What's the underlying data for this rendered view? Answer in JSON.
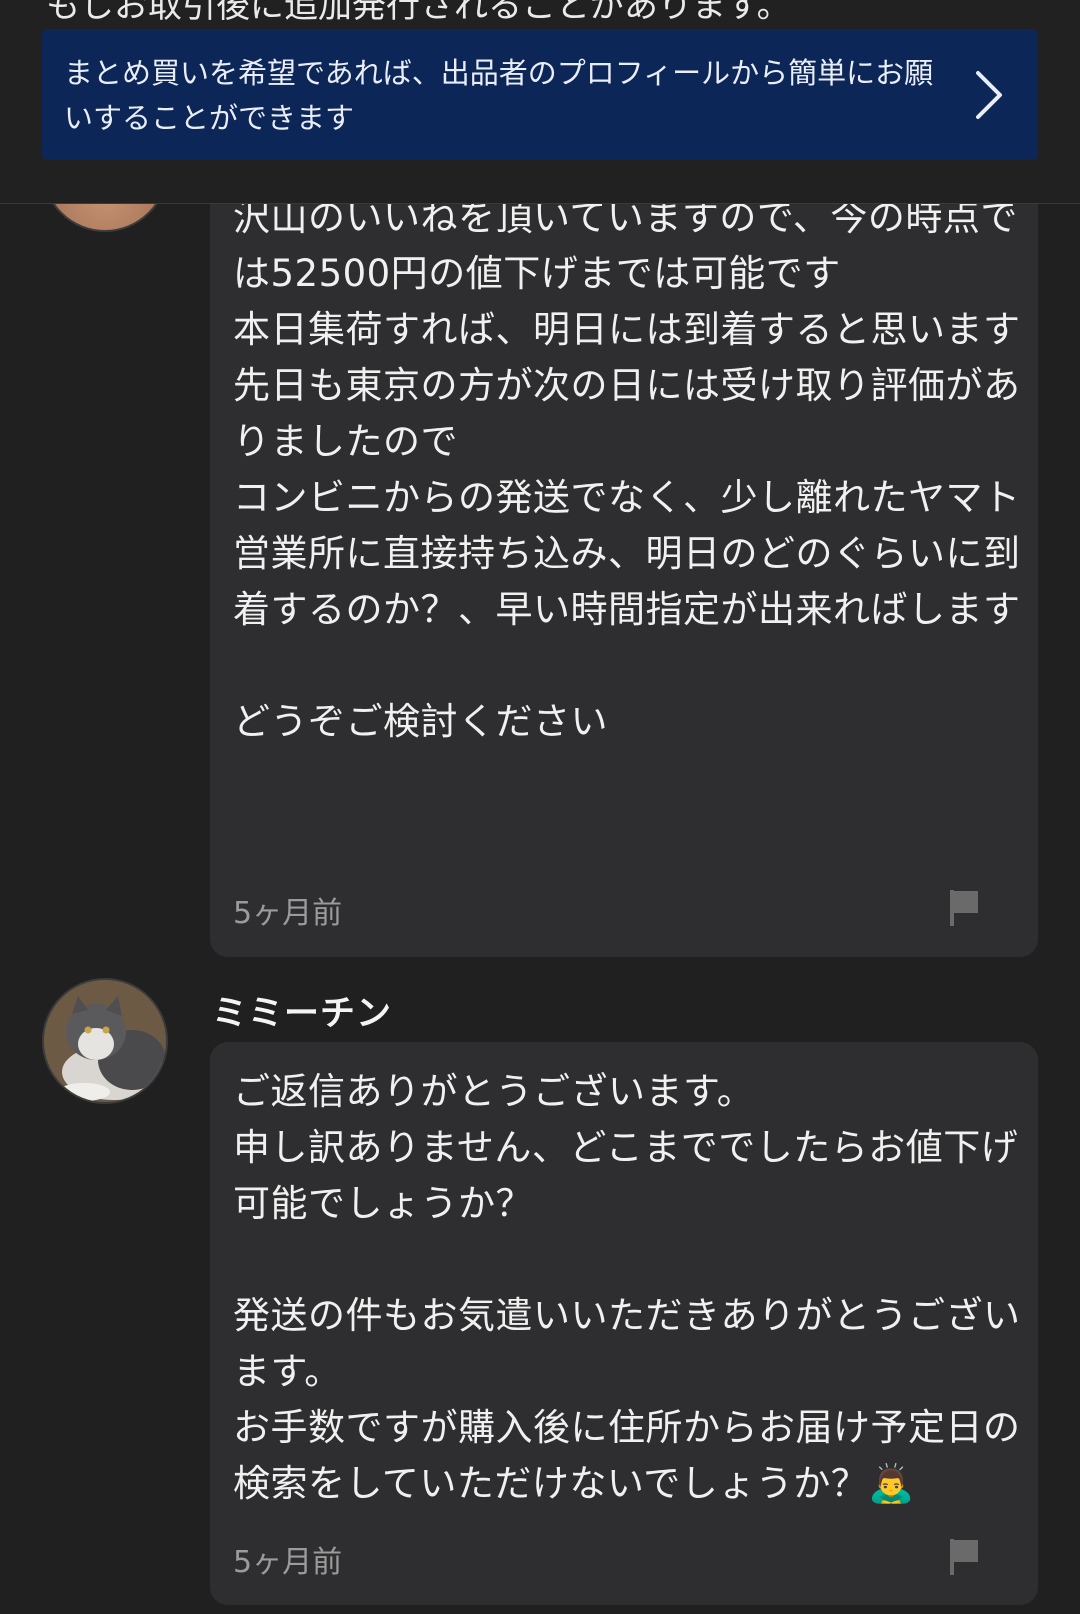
{
  "header": {
    "clipped_text": "もしお取引後に追加発行されることがあります。",
    "bulk_banner": {
      "text": "まとめ買いを希望であれば、出品者のプロフィールから簡単にお願いすることができます",
      "icon": "chevron-right-icon"
    }
  },
  "messages": [
    {
      "author": "",
      "avatar_icon": "avatar-seller",
      "text": "沢山のいいねを頂いていますので、今の時点では52500円の値下げまでは可能です\n本日集荷すれば、明日には到着すると思います\n先日も東京の方が次の日には受け取り評価がありましたので\nコンビニからの発送でなく、少し離れたヤマト営業所に直接持ち込み、明日のどのぐらいに到着するのか？、早い時間指定が出来ればします\n\nどうぞご検討ください",
      "time": "5ヶ月前",
      "flag_icon": "flag-icon"
    },
    {
      "author": "ミミーチン",
      "avatar_icon": "cat-avatar",
      "text": "ご返信ありがとうございます。\n申し訳ありません、どこまででしたらお値下げ可能でしょうか？\n\n発送の件もお気遣いいただきありがとうございます。\nお手数ですが購入後に住所からお届け予定日の検索をしていただけないでしょうか？🙇‍♂️",
      "time": "5ヶ月前",
      "flag_icon": "flag-icon"
    }
  ]
}
